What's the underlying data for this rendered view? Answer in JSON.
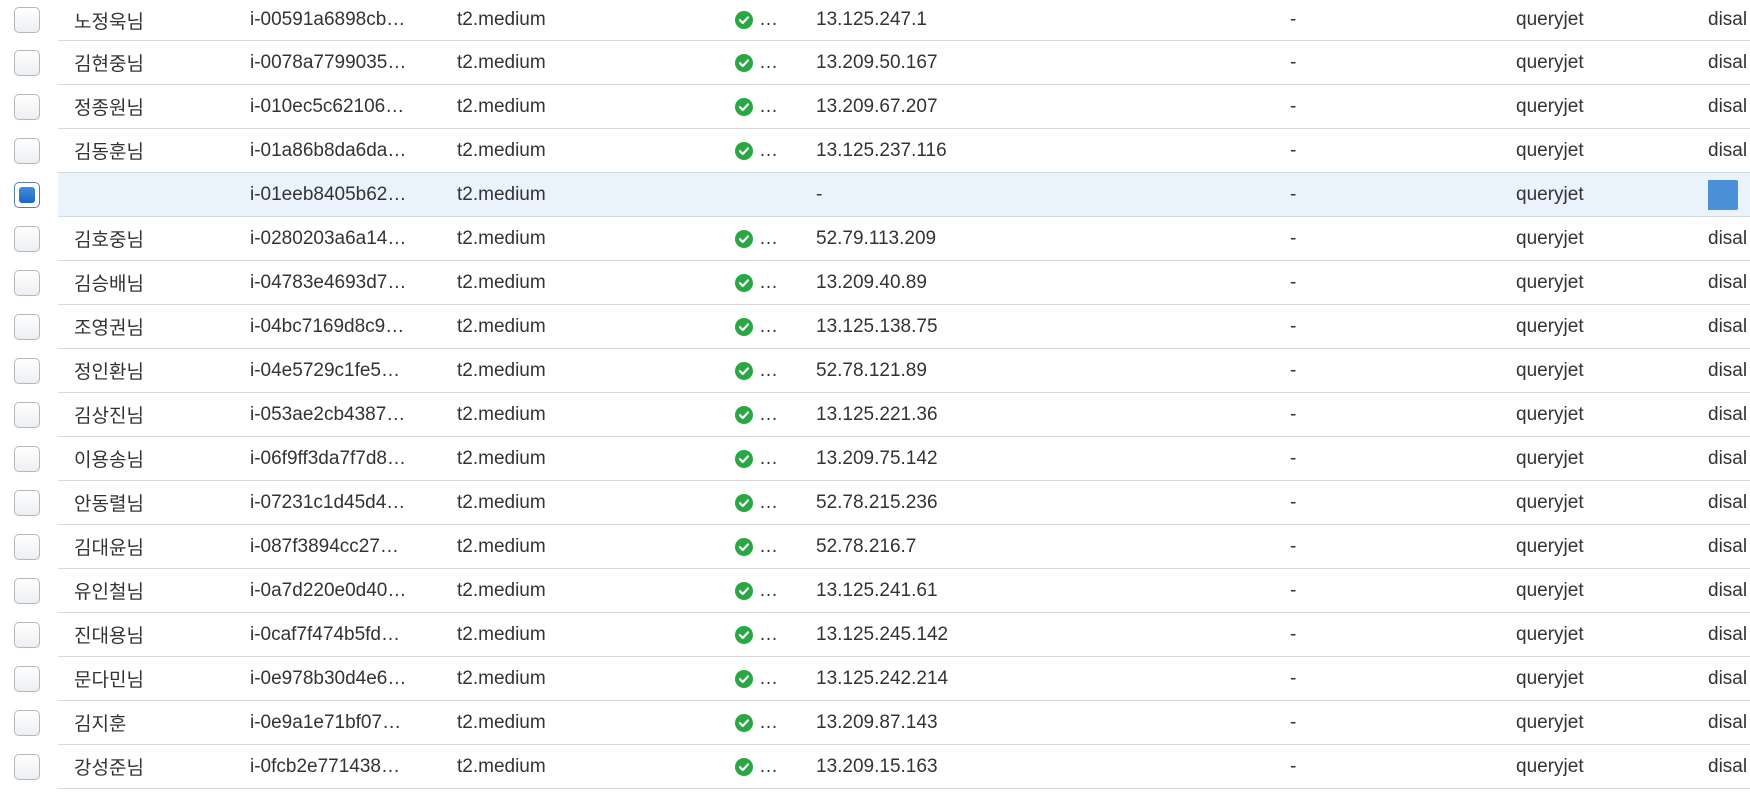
{
  "rows": [
    {
      "name": "노정욱님",
      "instance_id": "i-00591a6898cb…",
      "type": "t2.medium",
      "status": "ok",
      "status_ellipsis": "…",
      "ip": "13.125.247.1",
      "dash": "-",
      "key": "queryjet",
      "monitoring": "disal",
      "selected": false
    },
    {
      "name": "김현중님",
      "instance_id": "i-0078a7799035…",
      "type": "t2.medium",
      "status": "ok",
      "status_ellipsis": "…",
      "ip": "13.209.50.167",
      "dash": "-",
      "key": "queryjet",
      "monitoring": "disal",
      "selected": false
    },
    {
      "name": "정종원님",
      "instance_id": "i-010ec5c62106…",
      "type": "t2.medium",
      "status": "ok",
      "status_ellipsis": "…",
      "ip": "13.209.67.207",
      "dash": "-",
      "key": "queryjet",
      "monitoring": "disal",
      "selected": false
    },
    {
      "name": "김동훈님",
      "instance_id": "i-01a86b8da6da…",
      "type": "t2.medium",
      "status": "ok",
      "status_ellipsis": "…",
      "ip": "13.125.237.116",
      "dash": "-",
      "key": "queryjet",
      "monitoring": "disal",
      "selected": false
    },
    {
      "name": "",
      "instance_id": "i-01eeb8405b62…",
      "type": "t2.medium",
      "status": "",
      "status_ellipsis": "",
      "ip": "-",
      "dash": "-",
      "key": "queryjet",
      "monitoring": "",
      "selected": true
    },
    {
      "name": "김호중님",
      "instance_id": "i-0280203a6a14…",
      "type": "t2.medium",
      "status": "ok",
      "status_ellipsis": "…",
      "ip": "52.79.113.209",
      "dash": "-",
      "key": "queryjet",
      "monitoring": "disal",
      "selected": false
    },
    {
      "name": "김승배님",
      "instance_id": "i-04783e4693d7…",
      "type": "t2.medium",
      "status": "ok",
      "status_ellipsis": "…",
      "ip": "13.209.40.89",
      "dash": "-",
      "key": "queryjet",
      "monitoring": "disal",
      "selected": false
    },
    {
      "name": "조영권님",
      "instance_id": "i-04bc7169d8c9…",
      "type": "t2.medium",
      "status": "ok",
      "status_ellipsis": "…",
      "ip": "13.125.138.75",
      "dash": "-",
      "key": "queryjet",
      "monitoring": "disal",
      "selected": false
    },
    {
      "name": "정인환님",
      "instance_id": "i-04e5729c1fe5…",
      "type": "t2.medium",
      "status": "ok",
      "status_ellipsis": "…",
      "ip": "52.78.121.89",
      "dash": "-",
      "key": "queryjet",
      "monitoring": "disal",
      "selected": false
    },
    {
      "name": "김상진님",
      "instance_id": "i-053ae2cb4387…",
      "type": "t2.medium",
      "status": "ok",
      "status_ellipsis": "…",
      "ip": "13.125.221.36",
      "dash": "-",
      "key": "queryjet",
      "monitoring": "disal",
      "selected": false
    },
    {
      "name": "이용송님",
      "instance_id": "i-06f9ff3da7f7d8…",
      "type": "t2.medium",
      "status": "ok",
      "status_ellipsis": "…",
      "ip": "13.209.75.142",
      "dash": "-",
      "key": "queryjet",
      "monitoring": "disal",
      "selected": false
    },
    {
      "name": "안동렬님",
      "instance_id": "i-07231c1d45d4…",
      "type": "t2.medium",
      "status": "ok",
      "status_ellipsis": "…",
      "ip": "52.78.215.236",
      "dash": "-",
      "key": "queryjet",
      "monitoring": "disal",
      "selected": false
    },
    {
      "name": "김대윤님",
      "instance_id": "i-087f3894cc27…",
      "type": "t2.medium",
      "status": "ok",
      "status_ellipsis": "…",
      "ip": "52.78.216.7",
      "dash": "-",
      "key": "queryjet",
      "monitoring": "disal",
      "selected": false
    },
    {
      "name": "유인철님",
      "instance_id": "i-0a7d220e0d40…",
      "type": "t2.medium",
      "status": "ok",
      "status_ellipsis": "…",
      "ip": "13.125.241.61",
      "dash": "-",
      "key": "queryjet",
      "monitoring": "disal",
      "selected": false
    },
    {
      "name": "진대용님",
      "instance_id": "i-0caf7f474b5fd…",
      "type": "t2.medium",
      "status": "ok",
      "status_ellipsis": "…",
      "ip": "13.125.245.142",
      "dash": "-",
      "key": "queryjet",
      "monitoring": "disal",
      "selected": false
    },
    {
      "name": "문다민님",
      "instance_id": "i-0e978b30d4e6…",
      "type": "t2.medium",
      "status": "ok",
      "status_ellipsis": "…",
      "ip": "13.125.242.214",
      "dash": "-",
      "key": "queryjet",
      "monitoring": "disal",
      "selected": false
    },
    {
      "name": "김지훈",
      "instance_id": "i-0e9a1e71bf07…",
      "type": "t2.medium",
      "status": "ok",
      "status_ellipsis": "…",
      "ip": "13.209.87.143",
      "dash": "-",
      "key": "queryjet",
      "monitoring": "disal",
      "selected": false
    },
    {
      "name": "강성준님",
      "instance_id": "i-0fcb2e771438…",
      "type": "t2.medium",
      "status": "ok",
      "status_ellipsis": "…",
      "ip": "13.209.15.163",
      "dash": "-",
      "key": "queryjet",
      "monitoring": "disal",
      "selected": false
    }
  ],
  "colors": {
    "selected_row_bg": "#eaf3fc",
    "status_ok": "#28a745",
    "checkbox_checked": "#1f66c1",
    "monitor_button": "#4a90d9",
    "row_border": "#d5dbdb"
  },
  "icons": {
    "status_ok": "check-circle-icon",
    "checkbox": "checkbox-icon"
  }
}
